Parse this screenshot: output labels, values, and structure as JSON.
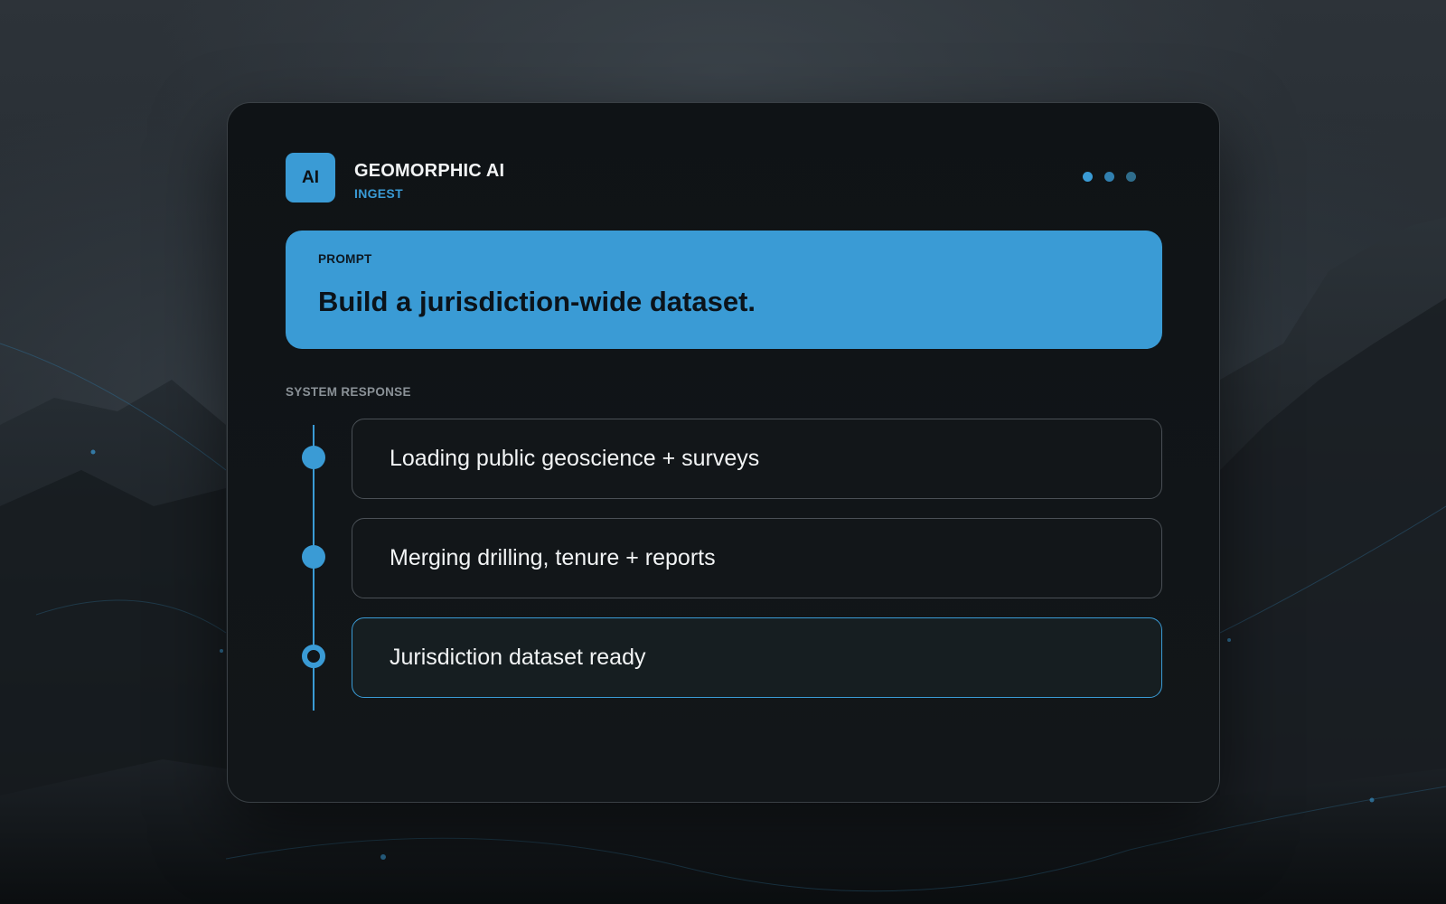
{
  "app": {
    "badge": "AI",
    "title": "GEOMORPHIC AI",
    "subtitle": "INGEST"
  },
  "prompt": {
    "label": "PROMPT",
    "text": "Build a jurisdiction-wide dataset."
  },
  "system_response": {
    "label": "SYSTEM RESPONSE",
    "steps": [
      {
        "text": "Loading public geoscience + surveys",
        "state": "complete"
      },
      {
        "text": "Merging drilling, tenure + reports",
        "state": "complete"
      },
      {
        "text": "Jurisdiction dataset ready",
        "state": "active"
      }
    ]
  },
  "colors": {
    "accent": "#3a9bd5",
    "panel_bg": "#111518",
    "text_primary": "#f2f4f5",
    "text_muted": "#8a9197"
  }
}
